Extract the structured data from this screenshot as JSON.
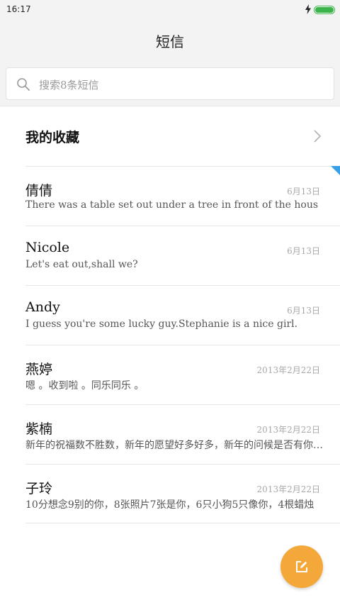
{
  "status_bar": {
    "time": "16:17",
    "battery_level": 1.0,
    "battery_color": "#3bb34a"
  },
  "header": {
    "title": "短信"
  },
  "search": {
    "placeholder": "搜索8条短信"
  },
  "favorites": {
    "label": "我的收藏"
  },
  "accent_colors": {
    "fab": "#f4a83a",
    "unread_marker": "#3aa0e6"
  },
  "conversations": [
    {
      "name": "倩倩",
      "date": "6月13日",
      "preview": "There was a table set out under a tree in front of the hous",
      "unread": true
    },
    {
      "name": "Nicole",
      "date": "6月13日",
      "preview": "Let's eat out,shall we?",
      "unread": false
    },
    {
      "name": "Andy",
      "date": "6月13日",
      "preview": "I guess you're some lucky guy.Stephanie is a nice girl.",
      "unread": false
    },
    {
      "name": "燕婷",
      "date": "2013年2月22日",
      "preview": "嗯 。收到啦 。同乐同乐 。",
      "unread": false
    },
    {
      "name": "紫楠",
      "date": "2013年2月22日",
      "preview": "新年的祝福数不胜数，新年的愿望好多好多，新年的问候是否有你的一份",
      "unread": false
    },
    {
      "name": "子玲",
      "date": "2013年2月22日",
      "preview": "10分想念9别的你，8张照片7张是你，6只小狗5只像你，4根蜡烛",
      "unread": false
    }
  ],
  "fab": {
    "icon": "compose-icon"
  }
}
